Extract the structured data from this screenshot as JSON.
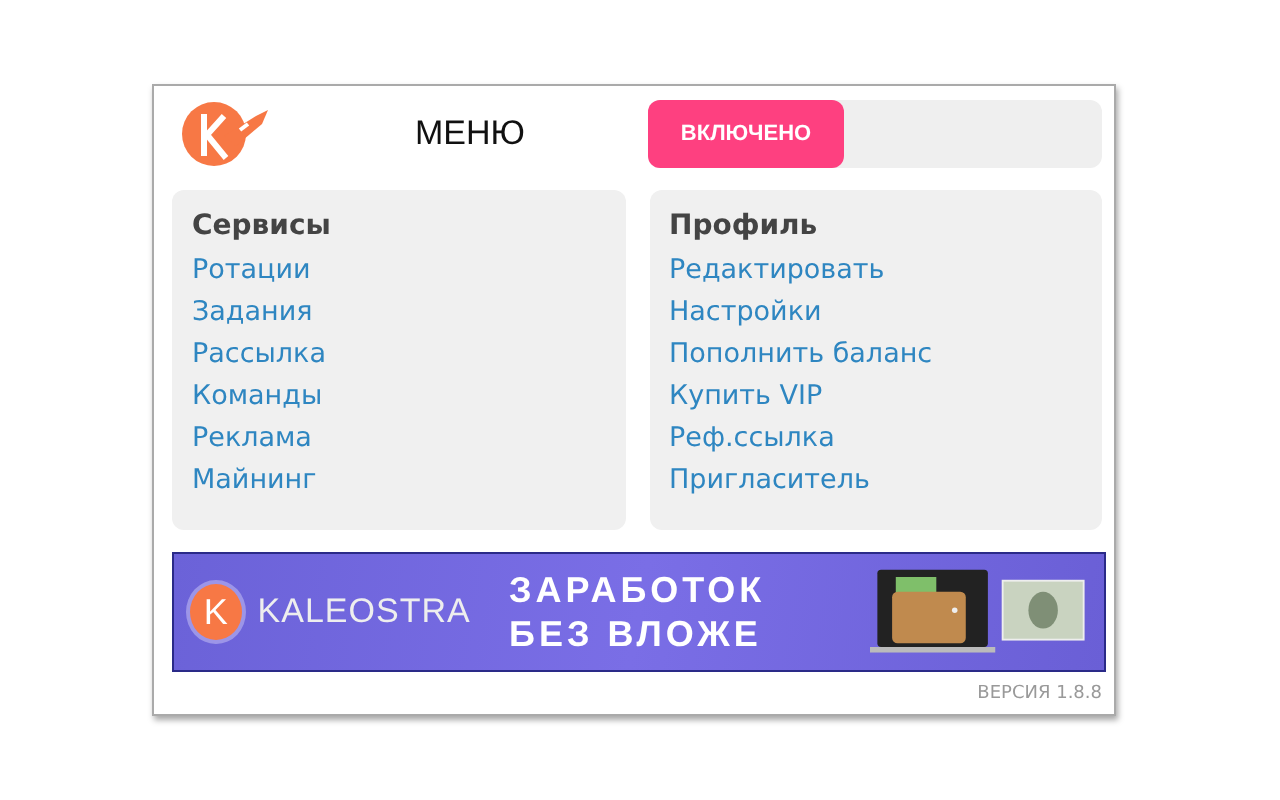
{
  "header": {
    "title": "МЕНЮ",
    "toggle": {
      "label": "ВКЛЮЧЕНО",
      "on": true
    }
  },
  "sections": [
    {
      "title": "Сервисы",
      "items": [
        "Ротации",
        "Задания",
        "Рассылка",
        "Команды",
        "Реклама",
        "Майнинг"
      ]
    },
    {
      "title": "Профиль",
      "items": [
        "Редактировать",
        "Настройки",
        "Пополнить баланс",
        "Купить VIP",
        "Реф.ссылка",
        "Пригласитель"
      ]
    }
  ],
  "banner": {
    "brand": "KALEOSTRA",
    "logo_letter": "K",
    "headline": "ЗАРАБОТОК БЕЗ ВЛОЖЕ"
  },
  "footer": {
    "version": "ВЕРСИЯ 1.8.8"
  }
}
